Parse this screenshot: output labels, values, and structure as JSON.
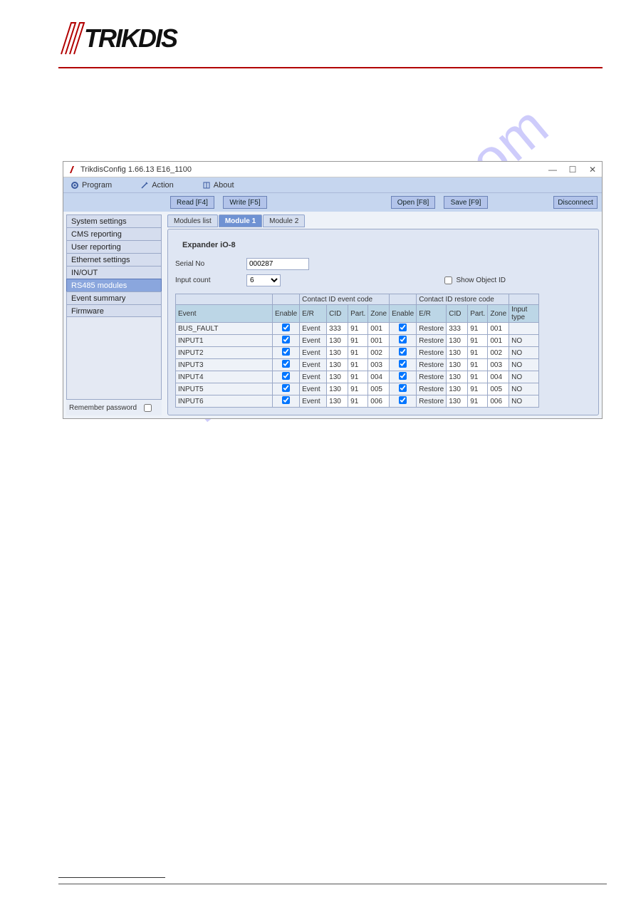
{
  "titlebar": {
    "app": "TrikdisConfig 1.66.13   E16_1100",
    "min": "—",
    "max": "☐",
    "close": "✕"
  },
  "menu": {
    "program": "Program",
    "action": "Action",
    "about": "About"
  },
  "toolbar": {
    "read": "Read [F4]",
    "write": "Write [F5]",
    "open": "Open [F8]",
    "save": "Save [F9]",
    "disconnect": "Disconnect"
  },
  "sidebar": {
    "items": [
      "System settings",
      "CMS reporting",
      "User reporting",
      "Ethernet settings",
      "IN/OUT",
      "RS485 modules",
      "Event summary",
      "Firmware"
    ],
    "active": 5,
    "remember": "Remember password"
  },
  "tabs": {
    "items": [
      "Modules list",
      "Module 1",
      "Module 2"
    ],
    "active": 1
  },
  "panel": {
    "title": "Expander iO-8",
    "serial_label": "Serial No",
    "serial_value": "000287",
    "input_count_label": "Input count",
    "input_count_value": "6",
    "show_object": "Show Object ID"
  },
  "grid": {
    "group1": "Contact ID event code",
    "group2": "Contact ID restore code",
    "cols": [
      "Event",
      "Enable",
      "E/R",
      "CID",
      "Part.",
      "Zone",
      "Enable",
      "E/R",
      "CID",
      "Part.",
      "Zone",
      "Input type"
    ],
    "rows": [
      {
        "event": "BUS_FAULT",
        "en1": true,
        "er1": "Event",
        "cid1": "333",
        "p1": "91",
        "z1": "001",
        "en2": true,
        "er2": "Restore",
        "cid2": "333",
        "p2": "91",
        "z2": "001",
        "it": ""
      },
      {
        "event": "INPUT1",
        "en1": true,
        "er1": "Event",
        "cid1": "130",
        "p1": "91",
        "z1": "001",
        "en2": true,
        "er2": "Restore",
        "cid2": "130",
        "p2": "91",
        "z2": "001",
        "it": "NO"
      },
      {
        "event": "INPUT2",
        "en1": true,
        "er1": "Event",
        "cid1": "130",
        "p1": "91",
        "z1": "002",
        "en2": true,
        "er2": "Restore",
        "cid2": "130",
        "p2": "91",
        "z2": "002",
        "it": "NO"
      },
      {
        "event": "INPUT3",
        "en1": true,
        "er1": "Event",
        "cid1": "130",
        "p1": "91",
        "z1": "003",
        "en2": true,
        "er2": "Restore",
        "cid2": "130",
        "p2": "91",
        "z2": "003",
        "it": "NO"
      },
      {
        "event": "INPUT4",
        "en1": true,
        "er1": "Event",
        "cid1": "130",
        "p1": "91",
        "z1": "004",
        "en2": true,
        "er2": "Restore",
        "cid2": "130",
        "p2": "91",
        "z2": "004",
        "it": "NO"
      },
      {
        "event": "INPUT5",
        "en1": true,
        "er1": "Event",
        "cid1": "130",
        "p1": "91",
        "z1": "005",
        "en2": true,
        "er2": "Restore",
        "cid2": "130",
        "p2": "91",
        "z2": "005",
        "it": "NO"
      },
      {
        "event": "INPUT6",
        "en1": true,
        "er1": "Event",
        "cid1": "130",
        "p1": "91",
        "z1": "006",
        "en2": true,
        "er2": "Restore",
        "cid2": "130",
        "p2": "91",
        "z2": "006",
        "it": "NO"
      }
    ]
  },
  "watermark": "manualshive.com"
}
